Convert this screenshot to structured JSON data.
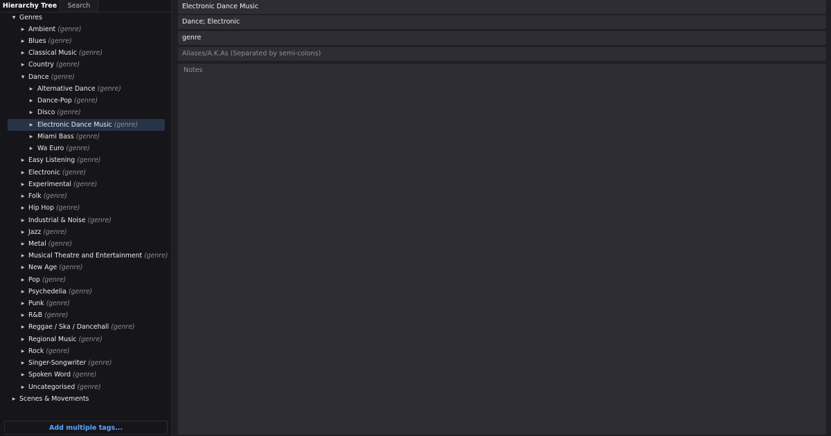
{
  "sidebar": {
    "tabs": [
      {
        "label": "Hierarchy Tree",
        "active": true
      },
      {
        "label": "Search",
        "active": false
      }
    ],
    "tree": [
      {
        "label": "Genres",
        "meta": "",
        "expanded": true
      },
      {
        "label": "Ambient",
        "meta": "(genre)"
      },
      {
        "label": "Blues",
        "meta": "(genre)"
      },
      {
        "label": "Classical Music",
        "meta": "(genre)"
      },
      {
        "label": "Country",
        "meta": "(genre)"
      },
      {
        "label": "Dance",
        "meta": "(genre)",
        "expanded": true
      },
      {
        "label": "Alternative Dance",
        "meta": "(genre)"
      },
      {
        "label": "Dance-Pop",
        "meta": "(genre)"
      },
      {
        "label": "Disco",
        "meta": "(genre)"
      },
      {
        "label": "Electronic Dance Music",
        "meta": "(genre)",
        "selected": true
      },
      {
        "label": "Miami Bass",
        "meta": "(genre)"
      },
      {
        "label": "Wa Euro",
        "meta": "(genre)"
      },
      {
        "label": "Easy Listening",
        "meta": "(genre)"
      },
      {
        "label": "Electronic",
        "meta": "(genre)"
      },
      {
        "label": "Experimental",
        "meta": "(genre)"
      },
      {
        "label": "Folk",
        "meta": "(genre)"
      },
      {
        "label": "Hip Hop",
        "meta": "(genre)"
      },
      {
        "label": "Industrial & Noise",
        "meta": "(genre)"
      },
      {
        "label": "Jazz",
        "meta": "(genre)"
      },
      {
        "label": "Metal",
        "meta": "(genre)"
      },
      {
        "label": "Musical Theatre and Entertainment",
        "meta": "(genre)"
      },
      {
        "label": "New Age",
        "meta": "(genre)"
      },
      {
        "label": "Pop",
        "meta": "(genre)"
      },
      {
        "label": "Psychedelia",
        "meta": "(genre)"
      },
      {
        "label": "Punk",
        "meta": "(genre)"
      },
      {
        "label": "R&B",
        "meta": "(genre)"
      },
      {
        "label": "Reggae / Ska / Dancehall",
        "meta": "(genre)"
      },
      {
        "label": "Regional Music",
        "meta": "(genre)"
      },
      {
        "label": "Rock",
        "meta": "(genre)"
      },
      {
        "label": "Singer-Songwriter",
        "meta": "(genre)"
      },
      {
        "label": "Spoken Word",
        "meta": "(genre)"
      },
      {
        "label": "Uncategorised",
        "meta": "(genre)"
      },
      {
        "label": "Scenes & Movements",
        "meta": ""
      }
    ],
    "add_button": "Add multiple tags..."
  },
  "editor": {
    "name_value": "Electronic Dance Music",
    "parents_value": "Dance; Electronic",
    "type_value": "genre",
    "aliases_placeholder": "Aliases/A.K.As (Separated by semi-colons)",
    "notes_placeholder": "Notes"
  },
  "colors": {
    "accent": "#5aa6ff",
    "selection": "#273448",
    "background": "#1c1c1f"
  }
}
